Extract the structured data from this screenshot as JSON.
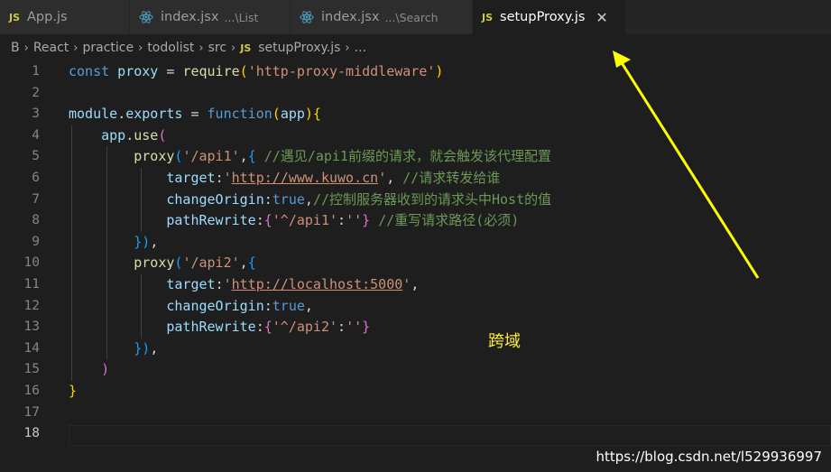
{
  "tabs": [
    {
      "label": "App.js",
      "desc": "",
      "icon": "js-file-icon",
      "active": false
    },
    {
      "label": "index.jsx",
      "desc": "...\\List",
      "icon": "react-icon",
      "active": false
    },
    {
      "label": "index.jsx",
      "desc": "...\\Search",
      "icon": "react-icon",
      "active": false
    },
    {
      "label": "setupProxy.js",
      "desc": "",
      "icon": "js-file-icon",
      "active": true
    }
  ],
  "js_icon_text": "JS",
  "close_glyph": "✕",
  "breadcrumb": {
    "items": [
      "B",
      "React",
      "practice",
      "todolist",
      "src"
    ],
    "file": "setupProxy.js",
    "more": "...",
    "separator": "›"
  },
  "lines": [
    {
      "n": "1",
      "parts": [
        [
          "kw",
          "const"
        ],
        [
          "",
          ""
        ],
        [
          "var",
          " proxy"
        ],
        [
          "",
          " = "
        ],
        [
          "fn",
          "require"
        ],
        [
          "br1",
          "("
        ],
        [
          "str",
          "'http-proxy-middleware'"
        ],
        [
          "br1",
          ")"
        ]
      ]
    },
    {
      "n": "2",
      "parts": []
    },
    {
      "n": "3",
      "parts": [
        [
          "var",
          "module"
        ],
        [
          "",
          "."
        ],
        [
          "var",
          "exports"
        ],
        [
          "",
          " = "
        ],
        [
          "kw",
          "function"
        ],
        [
          "br1",
          "("
        ],
        [
          "var",
          "app"
        ],
        [
          "br1",
          "){"
        ]
      ]
    },
    {
      "n": "4",
      "parts": [
        [
          "",
          "    "
        ],
        [
          "var",
          "app"
        ],
        [
          "",
          "."
        ],
        [
          "fn",
          "use"
        ],
        [
          "br2",
          "("
        ]
      ]
    },
    {
      "n": "5",
      "parts": [
        [
          "",
          "        "
        ],
        [
          "fn",
          "proxy"
        ],
        [
          "br3",
          "("
        ],
        [
          "str",
          "'/api1'"
        ],
        [
          "",
          ","
        ],
        [
          "br3",
          "{"
        ],
        [
          "",
          " "
        ],
        [
          "cmt",
          "//遇见/api1前缀的请求，就会触发该代理配置"
        ]
      ]
    },
    {
      "n": "6",
      "parts": [
        [
          "",
          "            "
        ],
        [
          "var",
          "target"
        ],
        [
          "",
          ":"
        ],
        [
          "str",
          "'"
        ],
        [
          "str url",
          "http://www.kuwo.cn"
        ],
        [
          "str",
          "'"
        ],
        [
          "",
          ", "
        ],
        [
          "cmt",
          "//请求转发给谁"
        ]
      ]
    },
    {
      "n": "7",
      "parts": [
        [
          "",
          "            "
        ],
        [
          "var",
          "changeOrigin"
        ],
        [
          "",
          ":"
        ],
        [
          "kw",
          "true"
        ],
        [
          "",
          ","
        ],
        [
          "cmt",
          "//控制服务器收到的请求头中Host的值"
        ]
      ]
    },
    {
      "n": "8",
      "parts": [
        [
          "",
          "            "
        ],
        [
          "var",
          "pathRewrite"
        ],
        [
          "",
          ":"
        ],
        [
          "br2",
          "{"
        ],
        [
          "str",
          "'^/api1'"
        ],
        [
          "",
          ":"
        ],
        [
          "str",
          "''"
        ],
        [
          "br2",
          "}"
        ],
        [
          "",
          " "
        ],
        [
          "cmt",
          "//重写请求路径(必须)"
        ]
      ]
    },
    {
      "n": "9",
      "parts": [
        [
          "",
          "        "
        ],
        [
          "br3",
          "})"
        ],
        [
          "",
          ","
        ]
      ]
    },
    {
      "n": "10",
      "parts": [
        [
          "",
          "        "
        ],
        [
          "fn",
          "proxy"
        ],
        [
          "br3",
          "("
        ],
        [
          "str",
          "'/api2'"
        ],
        [
          "",
          ","
        ],
        [
          "br3",
          "{"
        ]
      ]
    },
    {
      "n": "11",
      "parts": [
        [
          "",
          "            "
        ],
        [
          "var",
          "target"
        ],
        [
          "",
          ":"
        ],
        [
          "str",
          "'"
        ],
        [
          "str url",
          "http://localhost:5000"
        ],
        [
          "str",
          "'"
        ],
        [
          "",
          ","
        ]
      ]
    },
    {
      "n": "12",
      "parts": [
        [
          "",
          "            "
        ],
        [
          "var",
          "changeOrigin"
        ],
        [
          "",
          ":"
        ],
        [
          "kw",
          "true"
        ],
        [
          "",
          ","
        ]
      ]
    },
    {
      "n": "13",
      "parts": [
        [
          "",
          "            "
        ],
        [
          "var",
          "pathRewrite"
        ],
        [
          "",
          ":"
        ],
        [
          "br2",
          "{"
        ],
        [
          "str",
          "'^/api2'"
        ],
        [
          "",
          ":"
        ],
        [
          "str",
          "''"
        ],
        [
          "br2",
          "}"
        ]
      ]
    },
    {
      "n": "14",
      "parts": [
        [
          "",
          "        "
        ],
        [
          "br3",
          "})"
        ],
        [
          "",
          ","
        ]
      ]
    },
    {
      "n": "15",
      "parts": [
        [
          "",
          "    "
        ],
        [
          "br2",
          ")"
        ]
      ]
    },
    {
      "n": "16",
      "parts": [
        [
          "br1",
          "}"
        ]
      ]
    },
    {
      "n": "17",
      "parts": []
    },
    {
      "n": "18",
      "parts": []
    }
  ],
  "current_line": "18",
  "annotation_text": "跨域",
  "watermark": "https://blog.csdn.net/l529936997",
  "colors": {
    "arrow": "#ffff00",
    "editor_bg": "#1e1e1e",
    "tabbar_bg": "#252526"
  }
}
